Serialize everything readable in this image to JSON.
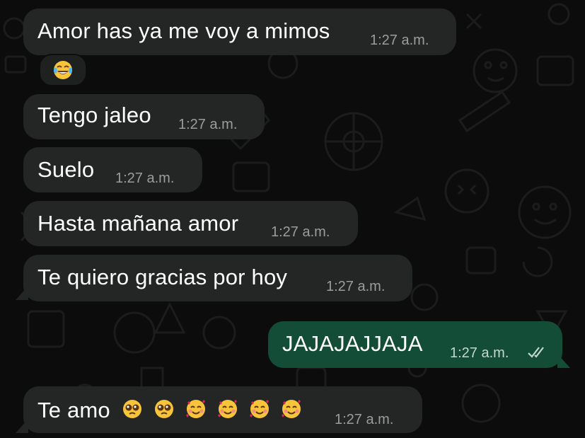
{
  "messages": [
    {
      "direction": "incoming",
      "text": "Amor has ya me voy a mimos",
      "time": "1:27 a.m.",
      "reaction": "face-with-tears-of-joy"
    },
    {
      "direction": "incoming",
      "text": "Tengo jaleo",
      "time": "1:27 a.m."
    },
    {
      "direction": "incoming",
      "text": "Suelo",
      "time": "1:27 a.m."
    },
    {
      "direction": "incoming",
      "text": "Hasta mañana amor",
      "time": "1:27 a.m."
    },
    {
      "direction": "incoming",
      "text": "Te quiero gracias por hoy",
      "time": "1:27 a.m."
    },
    {
      "direction": "outgoing",
      "text": "JAJAJAJJAJA",
      "time": "1:27 a.m.",
      "status": "read-double-check"
    },
    {
      "direction": "incoming",
      "text": "Te amo",
      "time": "1:27 a.m.",
      "emojis": [
        "pleading-face",
        "pleading-face",
        "smiling-face-with-hearts",
        "smiling-face-with-hearts",
        "smiling-face-with-hearts",
        "smiling-face-with-hearts"
      ]
    }
  ],
  "colors": {
    "background": "#0c0c0c",
    "incoming_bubble": "#242626",
    "outgoing_bubble": "#144d37",
    "timestamp": "#9a9d9e"
  }
}
